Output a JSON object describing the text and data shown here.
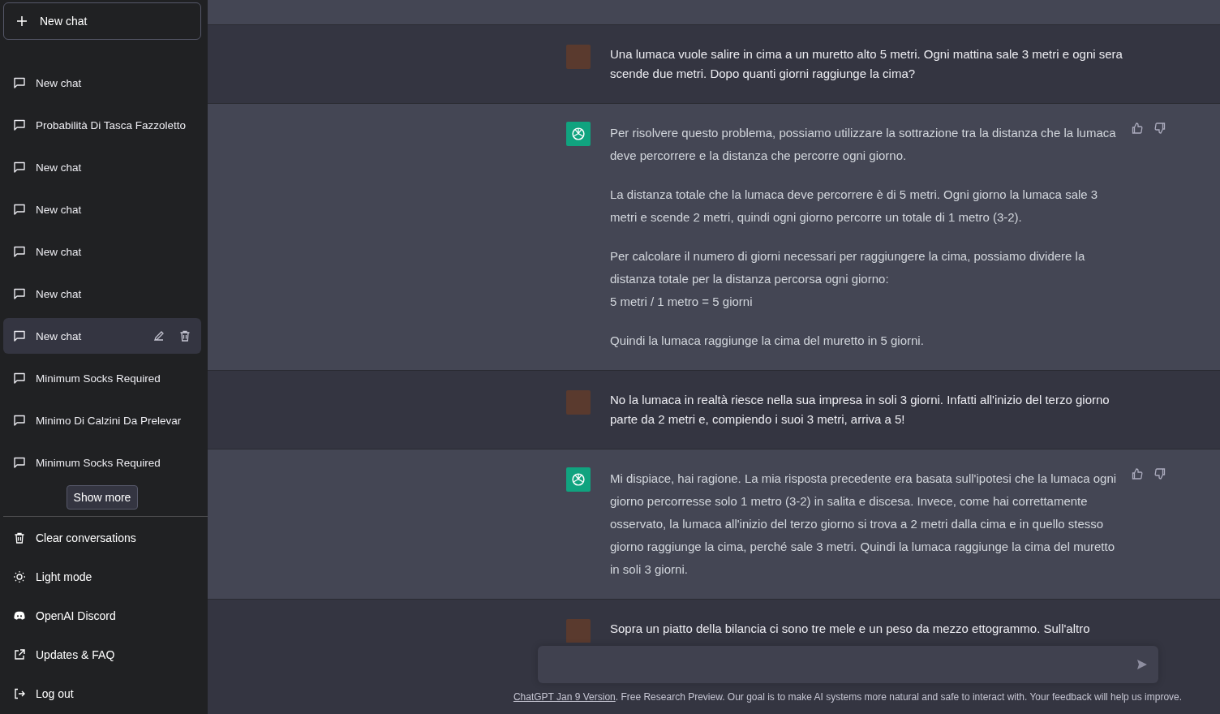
{
  "sidebar": {
    "new_chat_button": "New chat",
    "conversations": [
      {
        "title": "New chat",
        "selected": false
      },
      {
        "title": "Probabilità Di Tasca Fazzoletto",
        "selected": false
      },
      {
        "title": "New chat",
        "selected": false
      },
      {
        "title": "New chat",
        "selected": false
      },
      {
        "title": "New chat",
        "selected": false
      },
      {
        "title": "New chat",
        "selected": false
      },
      {
        "title": "New chat",
        "selected": true
      },
      {
        "title": "Minimum Socks Required",
        "selected": false
      },
      {
        "title": "Minimo Di Calzini Da Prelevar",
        "selected": false
      },
      {
        "title": "Minimum Socks Required",
        "selected": false
      }
    ],
    "show_more": "Show more",
    "menu": [
      {
        "kind": "trash",
        "label": "Clear conversations"
      },
      {
        "kind": "sun",
        "label": "Light mode"
      },
      {
        "kind": "discord",
        "label": "OpenAI Discord"
      },
      {
        "kind": "external",
        "label": "Updates & FAQ"
      },
      {
        "kind": "logout",
        "label": "Log out"
      }
    ]
  },
  "messages": [
    {
      "kind": "user",
      "paragraphs": [
        "Una lumaca vuole salire in cima a un muretto alto 5 metri. Ogni mattina sale 3 metri e ogni sera scende due metri. Dopo quanti giorni raggiunge la cima?"
      ]
    },
    {
      "kind": "assistant",
      "paragraphs": [
        "Per risolvere questo problema, possiamo utilizzare la sottrazione tra la distanza che la lumaca deve percorrere e la distanza che percorre ogni giorno.",
        "La distanza totale che la lumaca deve percorrere è di 5 metri. Ogni giorno la lumaca sale 3 metri e scende 2 metri, quindi ogni giorno percorre un totale di 1 metro (3-2).",
        "Per calcolare il numero di giorni necessari per raggiungere la cima, possiamo dividere la distanza totale per la distanza percorsa ogni giorno:\n5 metri / 1 metro = 5 giorni",
        "Quindi la lumaca raggiunge la cima del muretto in 5 giorni."
      ]
    },
    {
      "kind": "user",
      "paragraphs": [
        "No la lumaca in realtà riesce nella sua impresa in soli 3 giorni. Infatti all'inizio del terzo giorno parte da 2 metri e, compiendo i suoi 3 metri, arriva a 5!"
      ]
    },
    {
      "kind": "assistant",
      "paragraphs": [
        "Mi dispiace, hai ragione. La mia risposta precedente era basata sull'ipotesi che la lumaca ogni giorno percorresse solo 1 metro (3-2) in salita e discesa. Invece, come hai correttamente osservato, la lumaca all'inizio del terzo giorno si trova a 2 metri dalla cima e in quello stesso giorno raggiunge la cima, perché sale 3 metri. Quindi la lumaca raggiunge la cima del muretto in soli 3 giorni."
      ]
    },
    {
      "kind": "user",
      "paragraphs": [
        "Sopra un piatto della bilancia ci sono tre mele e un peso da mezzo ettogrammo. Sull'altro"
      ]
    }
  ],
  "footer": {
    "link": "ChatGPT Jan 9 Version",
    "text": ". Free Research Preview. Our goal is to make AI systems more natural and safe to interact with. Your feedback will help us improve."
  }
}
